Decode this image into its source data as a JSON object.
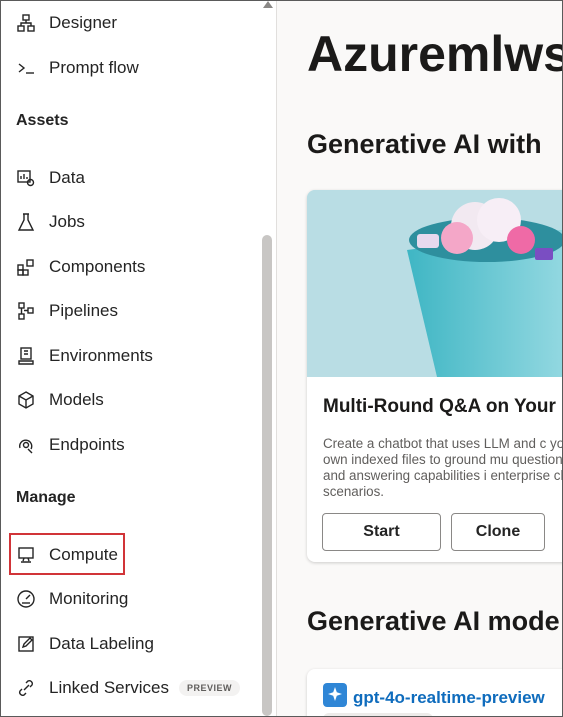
{
  "sidebar": {
    "items_top": [
      {
        "label": "Designer",
        "icon": "designer-icon"
      },
      {
        "label": "Prompt flow",
        "icon": "prompt-flow-icon"
      }
    ],
    "assets_heading": "Assets",
    "assets": [
      {
        "label": "Data",
        "icon": "data-icon"
      },
      {
        "label": "Jobs",
        "icon": "flask-icon"
      },
      {
        "label": "Components",
        "icon": "components-icon"
      },
      {
        "label": "Pipelines",
        "icon": "pipelines-icon"
      },
      {
        "label": "Environments",
        "icon": "environments-icon"
      },
      {
        "label": "Models",
        "icon": "cube-icon"
      },
      {
        "label": "Endpoints",
        "icon": "endpoints-icon"
      }
    ],
    "manage_heading": "Manage",
    "manage": [
      {
        "label": "Compute",
        "icon": "compute-icon",
        "highlighted": true
      },
      {
        "label": "Monitoring",
        "icon": "gauge-icon"
      },
      {
        "label": "Data Labeling",
        "icon": "edit-icon"
      },
      {
        "label": "Linked Services",
        "icon": "link-icon",
        "badge": "PREVIEW"
      }
    ]
  },
  "main": {
    "workspace_title": "Azuremlws",
    "section1_title": "Generative AI with",
    "card": {
      "title": "Multi-Round Q&A on Your",
      "description": "Create a chatbot that uses LLM and c your own indexed files to ground mu question and answering capabilities i enterprise chat scenarios.",
      "start_label": "Start",
      "clone_label": "Clone"
    },
    "section2_title": "Generative AI mode",
    "model_card": {
      "name": "gpt-4o-realtime-preview",
      "icon": "sparkle-icon"
    }
  },
  "colors": {
    "highlight_border": "#d13438",
    "link_blue": "#0f6cbd",
    "card_art_bg": "#b9dde4"
  }
}
